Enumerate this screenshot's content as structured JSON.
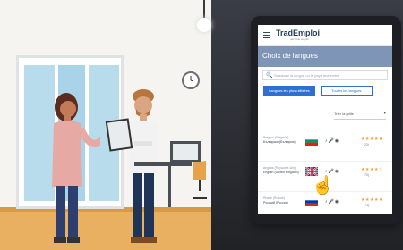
{
  "app": {
    "logo": "TradEmploi",
    "logo_tagline": "par Pôle emploi",
    "page_title": "Choix de langues",
    "search_placeholder": "Saisissez la langue ou le pays recherché",
    "tab_most_used": "Langues les plus utilisées",
    "tab_all": "Toutes les langues",
    "sort_label": "Trier la grille",
    "languages": [
      {
        "line1": "Bulgare (Bulgarie)",
        "line2": "Български (България)",
        "count": "(22)"
      },
      {
        "line1": "Anglais (Royaume-Uni)",
        "line2": "English (United Kingdom)",
        "count": "(70)"
      },
      {
        "line1": "Russe (Russie)",
        "line2": "Русский (Россия)",
        "count": "(71)"
      }
    ]
  },
  "colors": {
    "accent": "#2f6fd1",
    "header_band": "#7e95b8",
    "star": "#f0a030"
  },
  "icons": [
    "menu-icon",
    "search-icon",
    "chevron-down-icon",
    "audio-icon",
    "microphone-icon",
    "hand-pointer-icon",
    "clock-icon"
  ]
}
